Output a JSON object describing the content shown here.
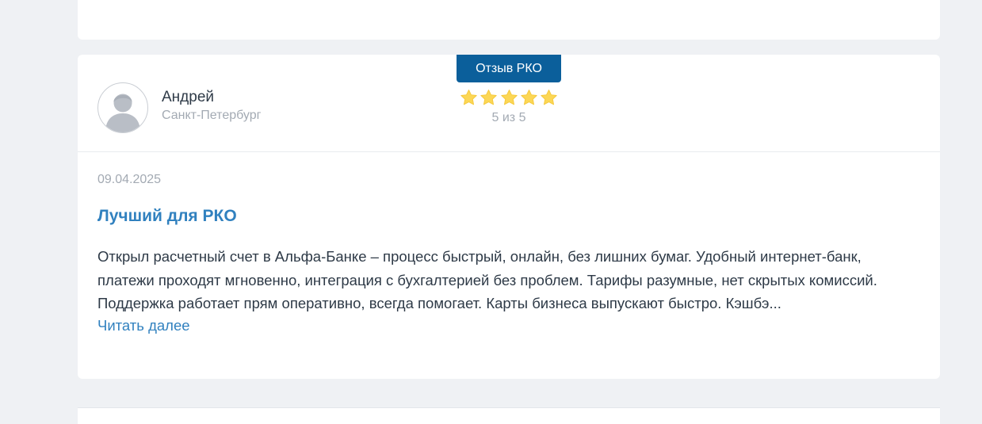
{
  "review": {
    "badge": "Отзыв РКО",
    "author": {
      "name": "Андрей",
      "city": "Санкт-Петербург",
      "avatar_icon": "user-avatar-icon"
    },
    "rating": {
      "value": 5,
      "max": 5,
      "text": "5 из 5",
      "star_icon": "star-icon"
    },
    "date": "09.04.2025",
    "title": "Лучший для РКО",
    "text": "Открыл расчетный счет в Альфа-Банке – процесс быстрый, онлайн, без лишних бумаг. Удобный интернет-банк, платежи проходят мгновенно, интеграция с бухгалтерией без проблем. Тарифы разумные, нет скрытых комиссий. Поддержка работает прям оперативно, всегда помогает. Карты бизнеса выпускают быстро. Кэшбэ...",
    "read_more": "Читать далее"
  },
  "colors": {
    "page_background": "#eff1f4",
    "card_background": "#ffffff",
    "badge_background": "#0b5f9b",
    "accent_link": "#3181bf",
    "star": "#fcd755",
    "muted_text": "#a3aab3",
    "body_text": "#2e3a47"
  }
}
